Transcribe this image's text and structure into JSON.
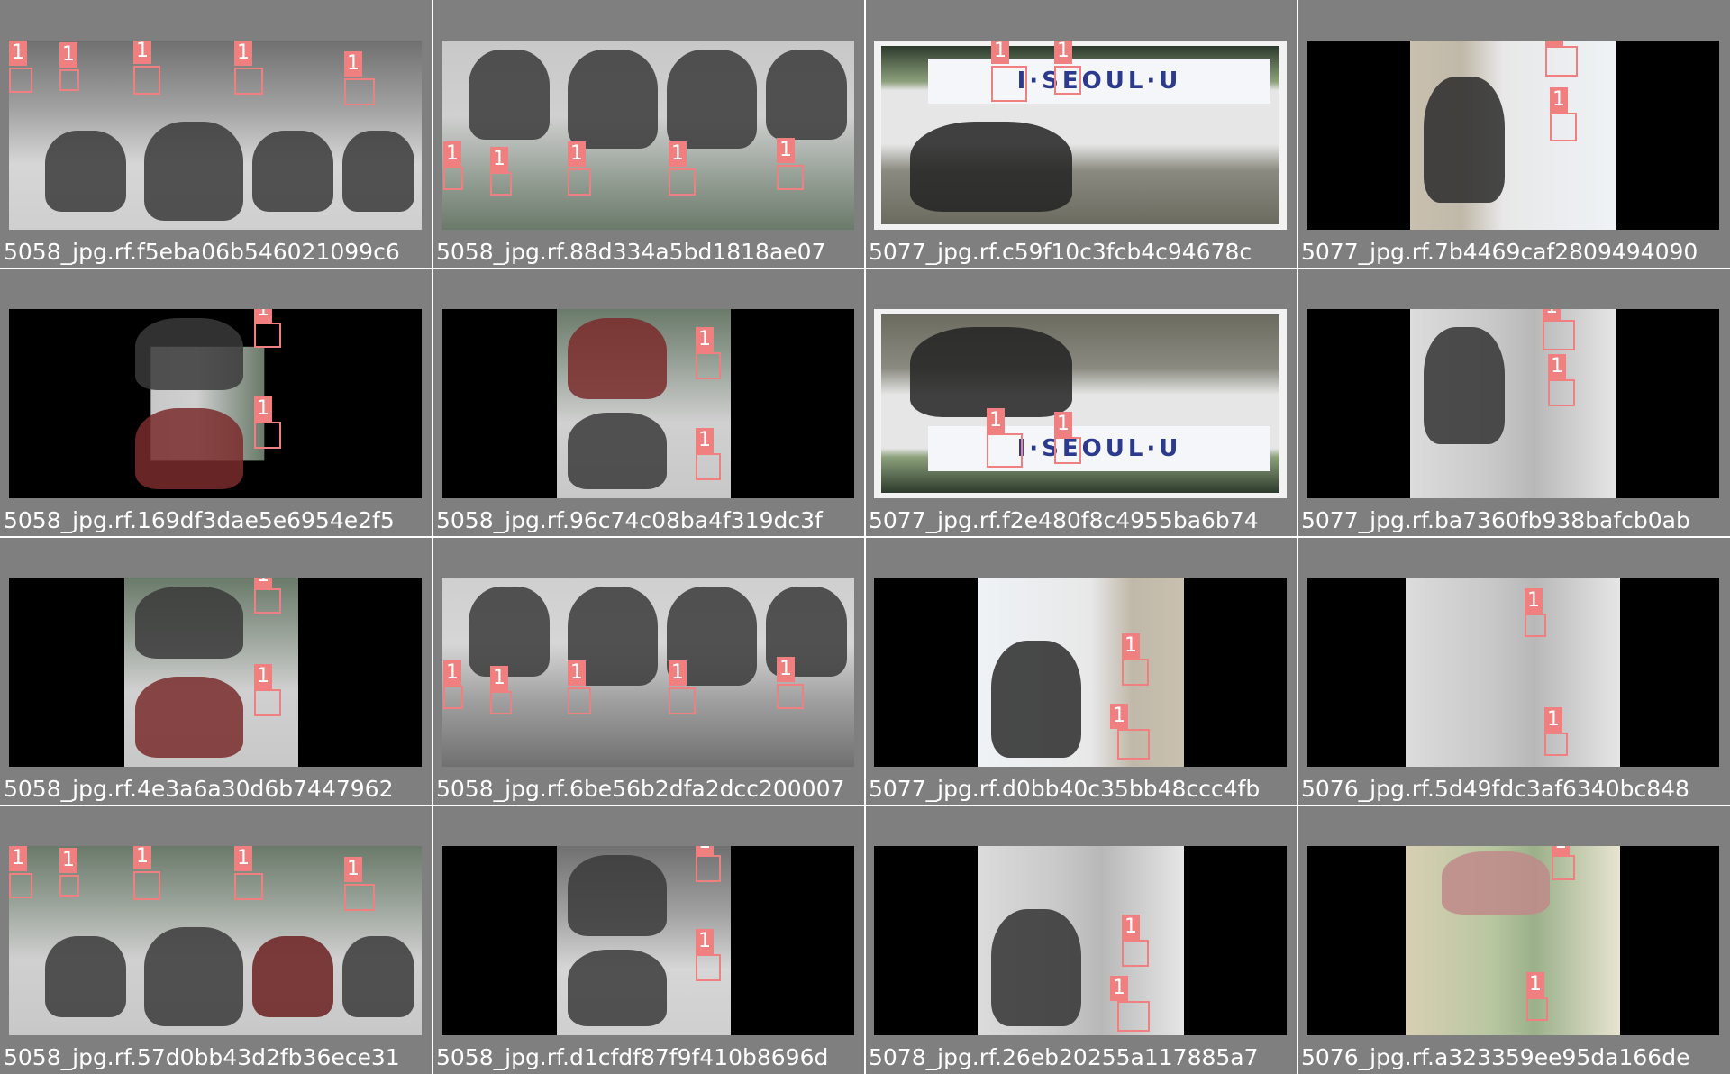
{
  "grid": {
    "tiles": [
      {
        "caption": "5058_jpg.rf.f5eba06b546021099c6",
        "label": "1"
      },
      {
        "caption": "5058_jpg.rf.88d334a5bd1818ae07",
        "label": "1"
      },
      {
        "caption": "5077_jpg.rf.c59f10c3fcb4c94678c",
        "label": "1"
      },
      {
        "caption": "5077_jpg.rf.7b4469caf2809494090",
        "label": "1"
      },
      {
        "caption": "5058_jpg.rf.169df3dae5e6954e2f5",
        "label": "1"
      },
      {
        "caption": "5058_jpg.rf.96c74c08ba4f319dc3f",
        "label": "1"
      },
      {
        "caption": "5077_jpg.rf.f2e480f8c4955ba6b74",
        "label": "1"
      },
      {
        "caption": "5077_jpg.rf.ba7360fb938bafcb0ab",
        "label": "1"
      },
      {
        "caption": "5058_jpg.rf.4e3a6a30d6b7447962",
        "label": "1"
      },
      {
        "caption": "5058_jpg.rf.6be56b2dfa2dcc200007",
        "label": "1"
      },
      {
        "caption": "5077_jpg.rf.d0bb40c35bb48ccc4fb",
        "label": "1"
      },
      {
        "caption": "5076_jpg.rf.5d49fdc3af6340bc848",
        "label": "1"
      },
      {
        "caption": "5058_jpg.rf.57d0bb43d2fb36ece31",
        "label": "1"
      },
      {
        "caption": "5058_jpg.rf.d1cfdf87f9f410b8696d",
        "label": "1"
      },
      {
        "caption": "5078_jpg.rf.26eb20255a117885a7",
        "label": "1"
      },
      {
        "caption": "5076_jpg.rf.a323359ee95da166de",
        "label": "1"
      }
    ]
  },
  "banner_text": "I·SEOUL·U",
  "colors": {
    "background": "#7f7f7f",
    "box": "#f08080",
    "caption": "#ffffff"
  }
}
